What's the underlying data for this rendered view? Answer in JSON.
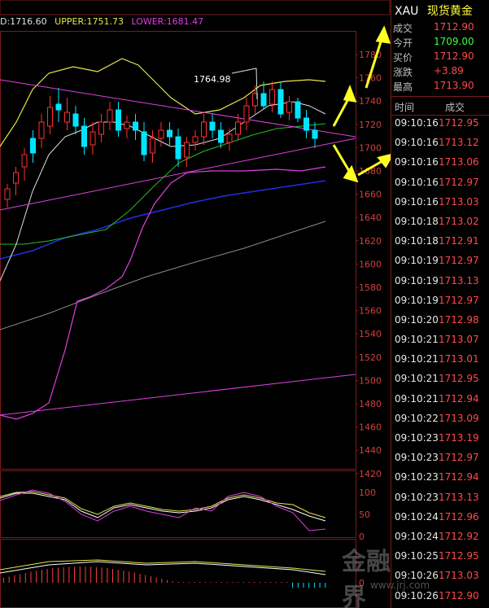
{
  "info_bar": {
    "mid": "D:1716.60",
    "upper": "UPPER:1751.73",
    "lower": "LOWER:1681.47"
  },
  "annotation_high": "1764.98",
  "price_axis": [
    "1780",
    "1760",
    "1740",
    "1720",
    "1700",
    "1680",
    "1660",
    "1640",
    "1620",
    "1600",
    "1580",
    "1560",
    "1540",
    "1520",
    "1500",
    "1480",
    "1460",
    "1440",
    "1420"
  ],
  "osc_axis": [
    "100",
    "50",
    "0"
  ],
  "macd_axis": [
    "0"
  ],
  "quote": {
    "symbol": "XAU",
    "name": "现货黄金",
    "rows": [
      {
        "label": "成交",
        "value": "1712.90",
        "color": "red"
      },
      {
        "label": "今开",
        "value": "1709.00",
        "color": "green"
      },
      {
        "label": "买价",
        "value": "1712.90",
        "color": "red"
      },
      {
        "label": "涨跌",
        "value": "+3.89",
        "color": "red"
      },
      {
        "label": "最高",
        "value": "1713.90",
        "color": "red"
      }
    ]
  },
  "ticks_header": {
    "time": "时间",
    "price": "成交"
  },
  "ticks": [
    {
      "time": "09:10:16",
      "price": "1712.95"
    },
    {
      "time": "09:10:16",
      "price": "1713.12"
    },
    {
      "time": "09:10:16",
      "price": "1713.06"
    },
    {
      "time": "09:10:16",
      "price": "1712.97"
    },
    {
      "time": "09:10:16",
      "price": "1713.03"
    },
    {
      "time": "09:10:18",
      "price": "1713.02"
    },
    {
      "time": "09:10:18",
      "price": "1712.91"
    },
    {
      "time": "09:10:19",
      "price": "1712.97"
    },
    {
      "time": "09:10:19",
      "price": "1713.13"
    },
    {
      "time": "09:10:19",
      "price": "1712.97"
    },
    {
      "time": "09:10:20",
      "price": "1712.98"
    },
    {
      "time": "09:10:21",
      "price": "1713.07"
    },
    {
      "time": "09:10:21",
      "price": "1713.01"
    },
    {
      "time": "09:10:21",
      "price": "1712.95"
    },
    {
      "time": "09:10:21",
      "price": "1712.94"
    },
    {
      "time": "09:10:22",
      "price": "1713.09"
    },
    {
      "time": "09:10:23",
      "price": "1713.19"
    },
    {
      "time": "09:10:23",
      "price": "1712.97"
    },
    {
      "time": "09:10:23",
      "price": "1712.94"
    },
    {
      "time": "09:10:23",
      "price": "1713.13"
    },
    {
      "time": "09:10:24",
      "price": "1712.96"
    },
    {
      "time": "09:10:24",
      "price": "1712.92"
    },
    {
      "time": "09:10:25",
      "price": "1712.95"
    },
    {
      "time": "09:10:26",
      "price": "1713.03"
    },
    {
      "time": "09:10:26",
      "price": "1712.90"
    }
  ],
  "watermark": {
    "text": "金融界",
    "url": "www.jrj.com"
  }
}
